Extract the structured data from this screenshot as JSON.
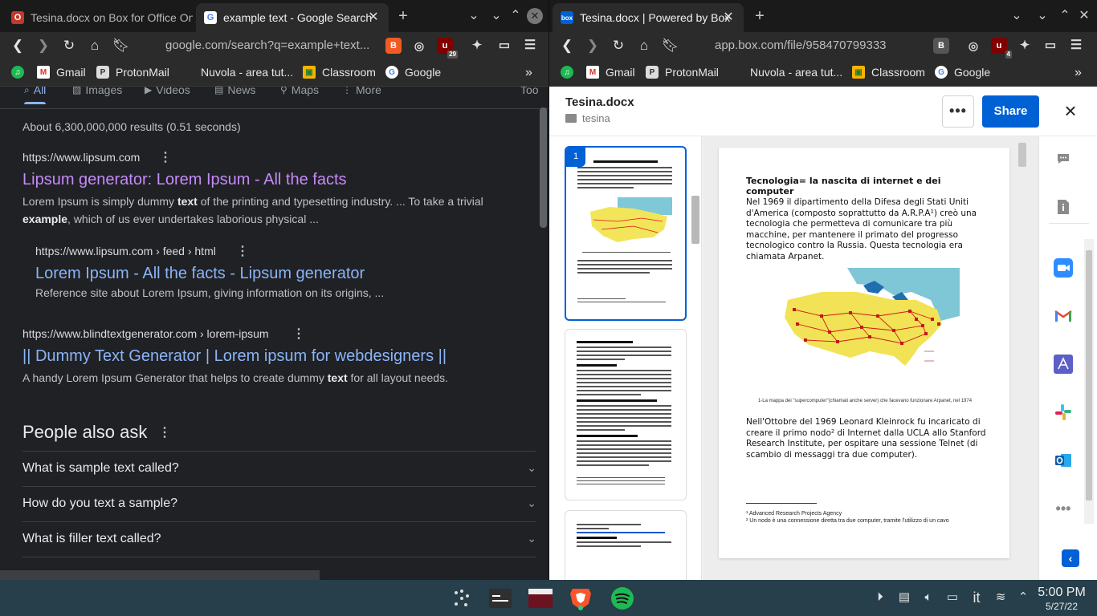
{
  "left_window": {
    "tabs": [
      {
        "label": "Tesina.docx on Box for Office Onli",
        "active": false
      },
      {
        "label": "example text - Google Search",
        "active": true
      }
    ],
    "url": "google.com/search?q=example+text...",
    "ext_badges": {
      "ublock": "29"
    },
    "bookmarks": [
      "Gmail",
      "ProtonMail",
      "Nuvola - area tut...",
      "Classroom",
      "Google"
    ]
  },
  "google": {
    "tabs": [
      "All",
      "Images",
      "Videos",
      "News",
      "Maps",
      "More",
      "Too"
    ],
    "stats": "About 6,300,000,000 results (0.51 seconds)",
    "results": [
      {
        "url": "https://www.lipsum.com",
        "title": "Lipsum generator: Lorem Ipsum - All the facts",
        "snippet_1a": "Lorem Ipsum is simply dummy ",
        "snippet_1b": "text",
        "snippet_1c": " of the printing and typesetting industry. ... To take a trivial",
        "snippet_2a": "example",
        "snippet_2b": ", which of us ever undertakes laborious physical ..."
      },
      {
        "url": "https://www.lipsum.com › feed › html",
        "title": "Lorem Ipsum - All the facts - Lipsum generator",
        "snippet": "Reference site about Lorem Ipsum, giving information on its origins, ..."
      },
      {
        "url": "https://www.blindtextgenerator.com › lorem-ipsum",
        "title": "|| Dummy Text Generator | Lorem ipsum for webdesigners ||",
        "snippet_a": "A handy Lorem Ipsum Generator that helps to create dummy ",
        "snippet_b": "text",
        "snippet_c": " for all layout needs."
      }
    ],
    "people_also_ask": {
      "title": "People also ask",
      "questions": [
        "What is sample text called?",
        "How do you text a sample?",
        "What is filler text called?"
      ]
    }
  },
  "right_window": {
    "tab_label": "Tesina.docx | Powered by Box",
    "url": "app.box.com/file/958470799333",
    "ext_badges": {
      "ublock": "4"
    },
    "bookmarks": [
      "Gmail",
      "ProtonMail",
      "Nuvola - area tut...",
      "Classroom",
      "Google"
    ]
  },
  "box": {
    "file_name": "Tesina.docx",
    "folder": "tesina",
    "more_label": "•••",
    "share_label": "Share",
    "page_number": "1",
    "page": {
      "title": "Tecnologia= la nascita di internet e dei computer",
      "para1": "Nel 1969 il dipartimento della Difesa degli Stati Uniti d'America (composto soprattutto da A.R.P.A¹) creò una tecnologia che permetteva di comunicare tra più macchine, per mantenere il primato del progresso tecnologico contro la Russia. Questa tecnologia era chiamata Arpanet.",
      "caption": "1-La mappa dei \"supercomputer\"(chiamati anche server) che facevano funzionare Arpanet, nel 1974",
      "para2": "Nell'Ottobre del 1969 Leonard Kleinrock fu incaricato di creare il primo nodo² di Internet dalla UCLA allo Stanford Research Institute, per ospitare una sessione Telnet (di scambio di messaggi tra due computer).",
      "footnote1": "¹ Advanced Research Projects Agency",
      "footnote2": "² Un nodo è una connessione diretta tra due computer, tramite l'utilizzo di un cavo"
    }
  },
  "taskbar": {
    "time": "5:00 PM",
    "date": "5/27/22",
    "lang": "it"
  },
  "colors": {
    "box_blue": "#0061d5",
    "google_link_visited": "#c58af9",
    "google_link": "#8ab4f8",
    "taskbar": "#263f4a"
  }
}
